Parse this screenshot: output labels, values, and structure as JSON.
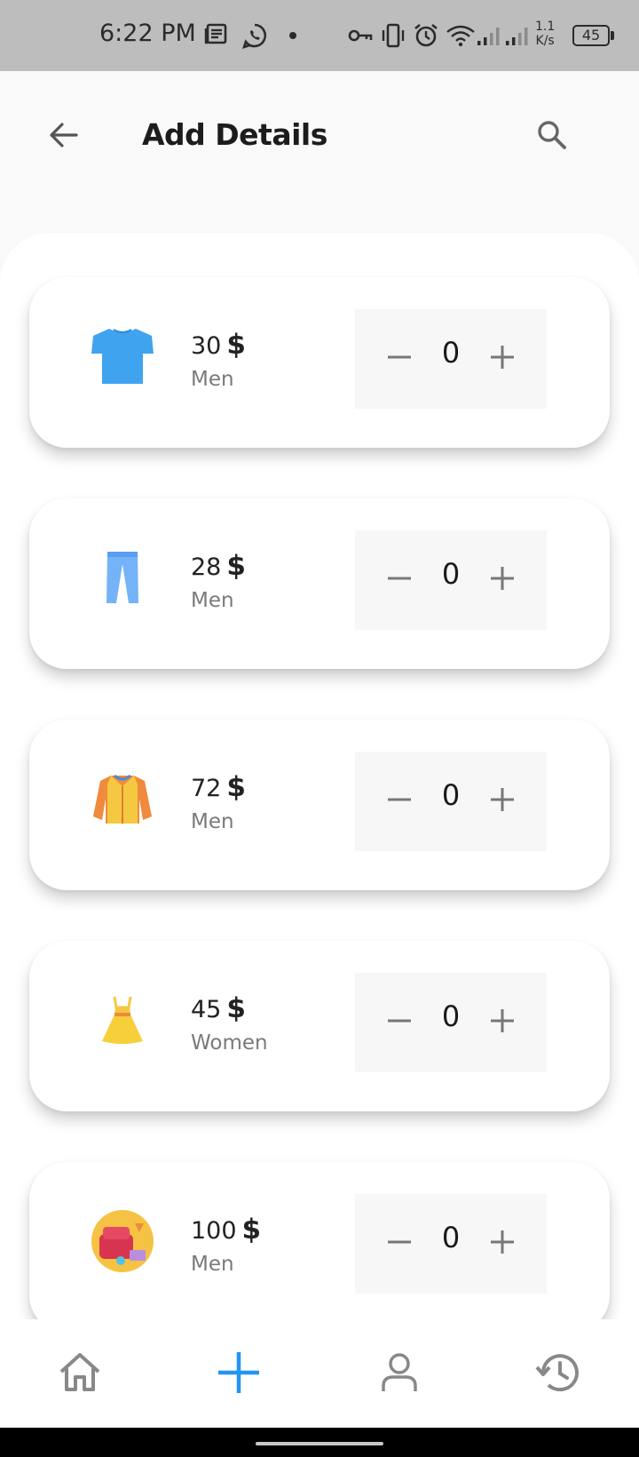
{
  "status_bar": {
    "time": "6:22 PM",
    "speed_value": "1.1",
    "speed_unit": "K/s",
    "battery": "45",
    "icons": [
      "news-icon",
      "whatsapp-icon",
      "dot-icon",
      "vpn-key-icon",
      "vibrate-icon",
      "alarm-icon",
      "wifi-icon",
      "signal-icon",
      "signal-icon",
      "battery-icon"
    ]
  },
  "app_bar": {
    "title": "Add Details",
    "back_icon": "arrow-left-icon",
    "search_icon": "search-icon"
  },
  "items": [
    {
      "price": "30",
      "currency": "$",
      "category": "Men",
      "quantity": "0",
      "icon": "tshirt-icon"
    },
    {
      "price": "28",
      "currency": "$",
      "category": "Men",
      "quantity": "0",
      "icon": "pants-icon"
    },
    {
      "price": "72",
      "currency": "$",
      "category": "Men",
      "quantity": "0",
      "icon": "jacket-icon"
    },
    {
      "price": "45",
      "currency": "$",
      "category": "Women",
      "quantity": "0",
      "icon": "dress-icon"
    },
    {
      "price": "100",
      "currency": "$",
      "category": "Men",
      "quantity": "0",
      "icon": "furniture-icon"
    }
  ],
  "bottom_nav": [
    {
      "icon": "home-icon",
      "active": false
    },
    {
      "icon": "add-icon",
      "active": true
    },
    {
      "icon": "profile-icon",
      "active": false
    },
    {
      "icon": "history-icon",
      "active": false
    }
  ],
  "colors": {
    "accent": "#2196f3",
    "inactive_icon": "#888888",
    "status_bar": "#bdbdbd"
  }
}
